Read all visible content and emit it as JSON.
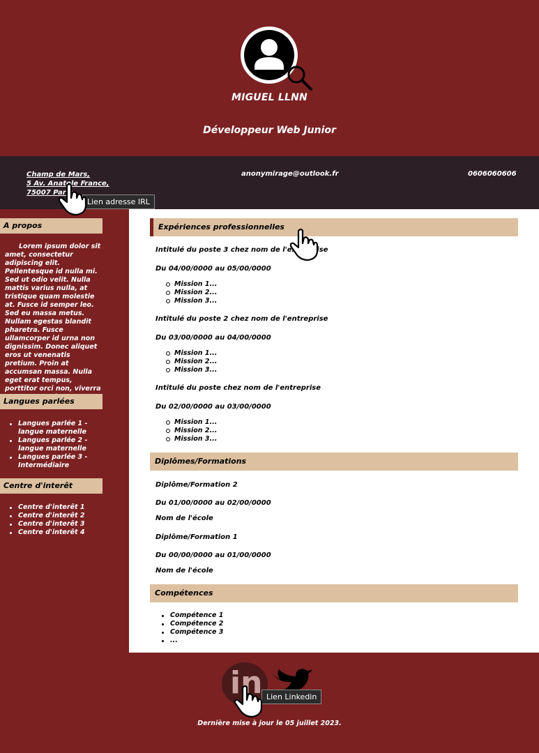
{
  "header": {
    "name": "MIGUEL LLNN",
    "role": "Développeur Web Junior"
  },
  "contact": {
    "address_line1": "Champ de Mars,",
    "address_line2": "5 Av. Anatole France,",
    "address_line3": "75007 Paris",
    "email": "anonymirage@outlook.fr",
    "phone": "0606060606",
    "address_tooltip": "Lien adresse IRL"
  },
  "sidebar": {
    "about_title": "A propos",
    "about_text": "Lorem ipsum dolor sit amet, consectetur adipiscing elit. Pellentesque id nulla mi. Sed ut odio velit. Nulla mattis varius nulla, at tristique quam molestie at. Fusce id semper leo. Sed eu massa metus. Nullam egestas blandit pharetra. Fusce ullamcorper id urna non dignissim. Donec aliquet eros ut venenatis pretium. Proin at accumsan massa. Nulla eget erat tempus, porttitor orci non, viverra sem. Donec sit amet mattis nisl.",
    "languages_title": "Langues parlées",
    "languages": [
      "Langues parlée 1 - langue maternelle",
      "Langues parlée 2 - langue maternelle",
      "Langues parlée 3 - Intermédiaire"
    ],
    "interests_title": "Centre d'interêt",
    "interests": [
      "Centre d'interêt 1",
      "Centre d'interêt 2",
      "Centre d'interêt 3",
      "Centre d'interêt 4"
    ]
  },
  "main": {
    "experience_title": "Expériences professionnelles",
    "jobs": [
      {
        "title": "Intitulé du poste 3 chez nom de l'entreprise",
        "dates": "Du 04/00/0000 au 05/00/0000",
        "missions": [
          "Mission 1...",
          "Mission 2...",
          "Mission 3..."
        ]
      },
      {
        "title": "Intitulé du poste 2 chez nom de l'entreprise",
        "dates": "Du 03/00/0000 au 04/00/0000",
        "missions": [
          "Mission 1...",
          "Mission 2...",
          "Mission 3..."
        ]
      },
      {
        "title": "Intitulé du poste chez nom de l'entreprise",
        "dates": "Du 02/00/0000 au 03/00/0000",
        "missions": [
          "Mission 1...",
          "Mission 2...",
          "Mission 3..."
        ]
      }
    ],
    "education_title": "Diplômes/Formations",
    "diplomas": [
      {
        "title": "Diplôme/Formation 2",
        "dates": "Du 01/00/0000 au 02/00/0000",
        "school": "Nom de l'école"
      },
      {
        "title": "Diplôme/Formation 1",
        "dates": "Du 00/00/0000 au 01/00/0000",
        "school": "Nom de l'école"
      }
    ],
    "skills_title": "Compétences",
    "skills": [
      "Compétence 1",
      "Compétence 2",
      "Compétence 3",
      "..."
    ]
  },
  "footer": {
    "linkedin_text": "in",
    "linkedin_tooltip": "Lien Linkedin",
    "updated": "Dernière mise à jour le 05 juillet 2023."
  },
  "icons": {
    "avatar": "user-circle-icon",
    "search": "magnifier-icon",
    "linkedin": "linkedin-icon",
    "twitter": "twitter-bird-icon",
    "cursor": "hand-pointer-icon"
  },
  "colors": {
    "brand": "#7b2122",
    "contact_bar": "#2c1f26",
    "section_header": "#dcc0a0",
    "panel": "#ffffff"
  }
}
